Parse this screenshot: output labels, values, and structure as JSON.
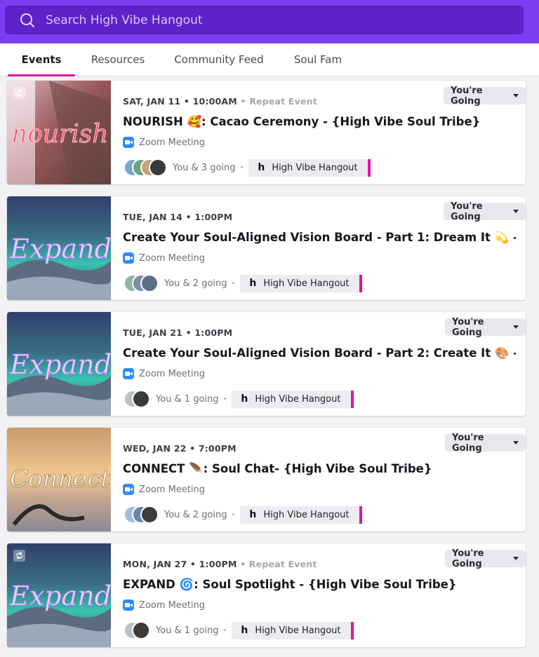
{
  "search": {
    "placeholder": "Search High Vibe Hangout"
  },
  "tabs": [
    {
      "label": "Events",
      "active": true
    },
    {
      "label": "Resources",
      "active": false
    },
    {
      "label": "Community Feed",
      "active": false
    },
    {
      "label": "Soul Fam",
      "active": false
    }
  ],
  "colors": {
    "brand": "#7c3cf0",
    "search_bg": "#5d22c8",
    "accent": "#e2139c",
    "zoom": "#2d8cff"
  },
  "events": [
    {
      "date": "SAT, JAN 11 • 10:00AM",
      "repeat": "• Repeat Event",
      "title": "NOURISH 🥰: Cacao Ceremony - {High Vibe Soul Tribe}",
      "platform": "Zoom Meeting",
      "going": "You & 3 going",
      "group": "High Vibe Hangout",
      "group_logo": "h",
      "rsvp": "You're Going",
      "thumb_text": "nourish",
      "has_repeat_icon": true
    },
    {
      "date": "TUE, JAN 14 • 1:00PM",
      "repeat": "",
      "title": "Create Your Soul-Aligned Vision Board - Part 1: Dream It 💫 -...",
      "platform": "Zoom Meeting",
      "going": "You & 2 going",
      "group": "High Vibe Hangout",
      "group_logo": "h",
      "rsvp": "You're Going",
      "thumb_text": "Expand",
      "has_repeat_icon": false
    },
    {
      "date": "TUE, JAN 21 • 1:00PM",
      "repeat": "",
      "title": "Create Your Soul-Aligned Vision Board - Part 2: Create It 🎨 -...",
      "platform": "Zoom Meeting",
      "going": "You & 1 going",
      "group": "High Vibe Hangout",
      "group_logo": "h",
      "rsvp": "You're Going",
      "thumb_text": "Expand",
      "has_repeat_icon": false
    },
    {
      "date": "WED, JAN 22 • 7:00PM",
      "repeat": "",
      "title": "CONNECT 🪶: Soul Chat- {High Vibe Soul Tribe}",
      "platform": "Zoom Meeting",
      "going": "You & 2 going",
      "group": "High Vibe Hangout",
      "group_logo": "h",
      "rsvp": "You're Going",
      "thumb_text": "Connect",
      "has_repeat_icon": false
    },
    {
      "date": "MON, JAN 27 • 1:00PM",
      "repeat": "• Repeat Event",
      "title": "EXPAND 🌀: Soul Spotlight - {High Vibe Soul Tribe}",
      "platform": "Zoom Meeting",
      "going": "You & 1 going",
      "group": "High Vibe Hangout",
      "group_logo": "h",
      "rsvp": "You're Going",
      "thumb_text": "Expand",
      "has_repeat_icon": true
    }
  ]
}
